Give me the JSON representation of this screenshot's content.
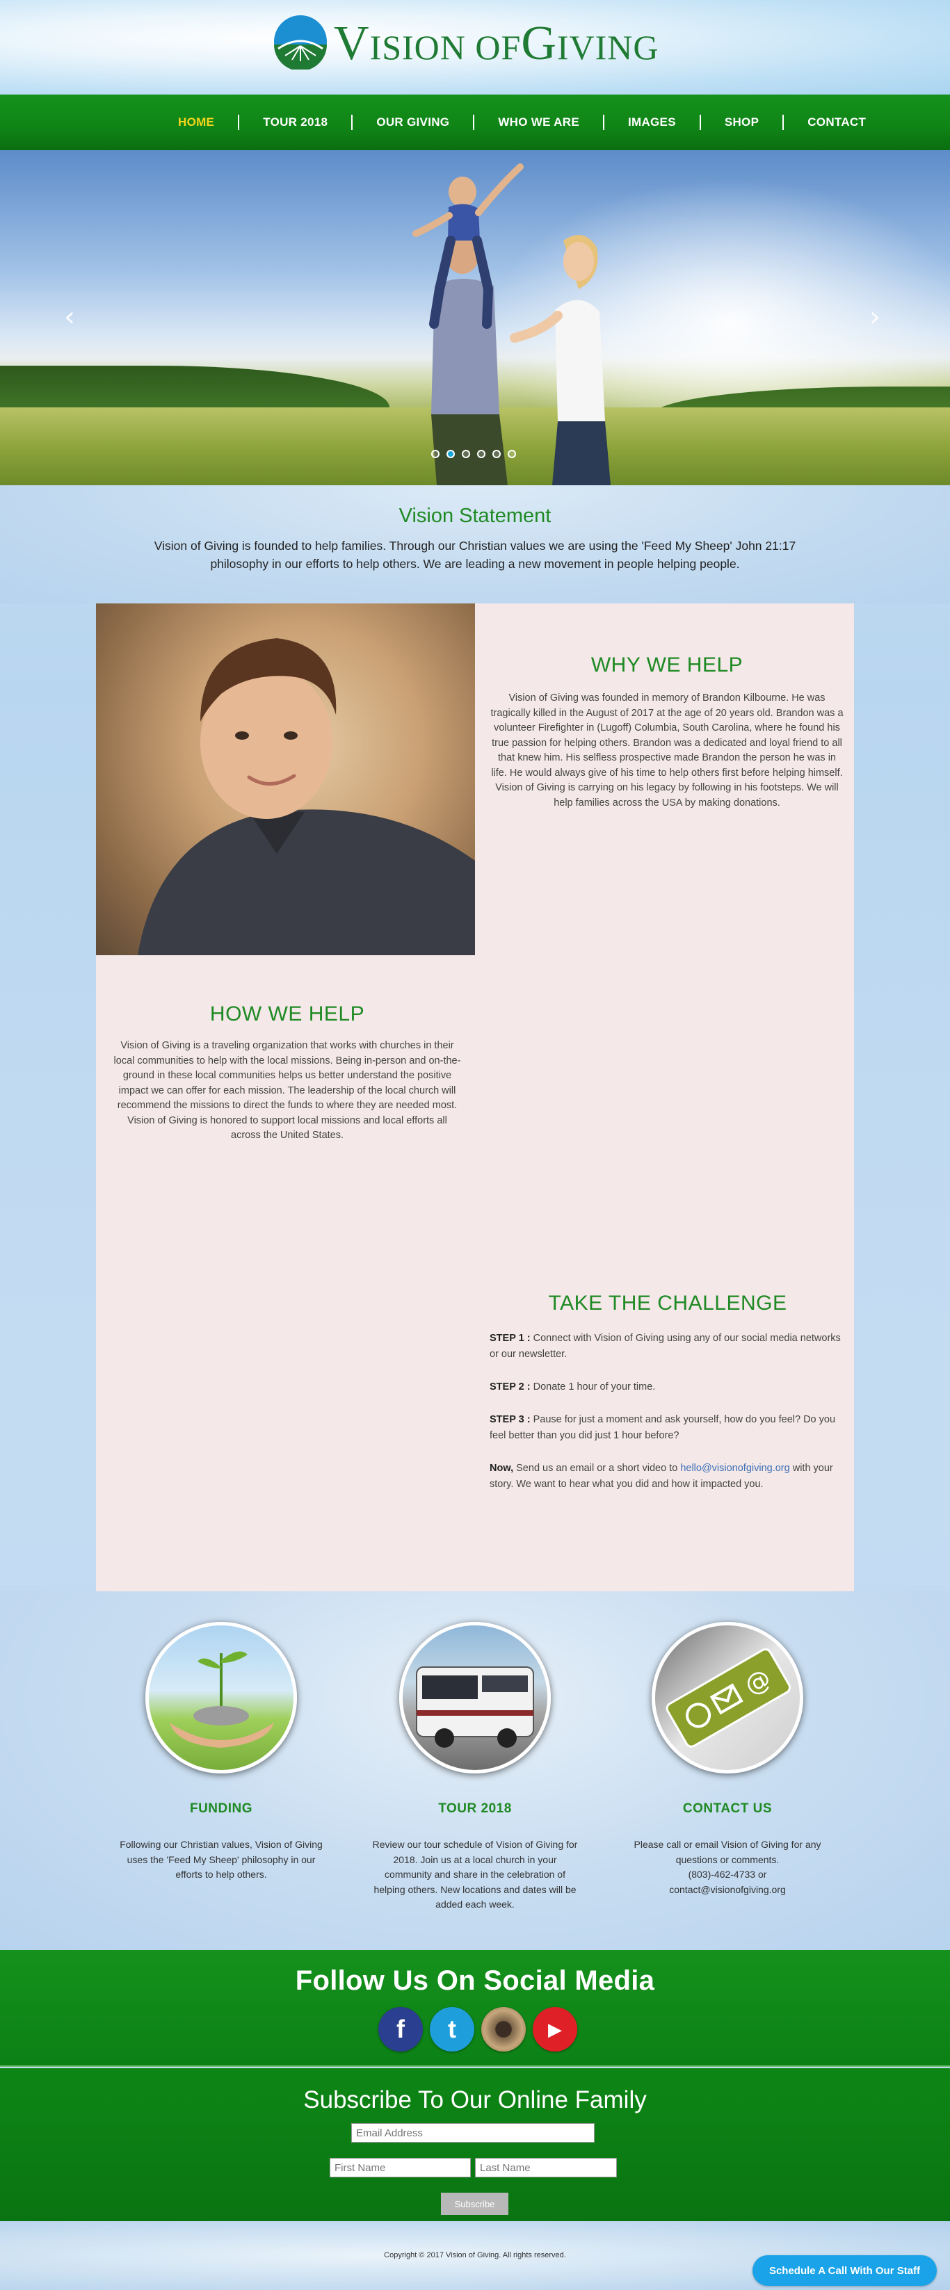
{
  "site": {
    "logo_text_prefix": "V",
    "logo_text_small1": "ISION",
    "logo_text_small2": " OF",
    "logo_text_g": "G",
    "logo_text_small3": "IVING"
  },
  "nav": {
    "items": [
      {
        "label": "HOME",
        "active": true
      },
      {
        "label": "TOUR 2018"
      },
      {
        "label": "OUR GIVING"
      },
      {
        "label": "WHO WE ARE"
      },
      {
        "label": "IMAGES"
      },
      {
        "label": "SHOP"
      },
      {
        "label": "CONTACT"
      }
    ]
  },
  "hero": {
    "prev_glyph": "‹",
    "next_glyph": "›",
    "slide_count": 6,
    "active_slide": 2
  },
  "vision": {
    "title": "Vision Statement",
    "body": "Vision of Giving is founded to help families. Through our Christian values we are using the 'Feed My Sheep' John 21:17 philosophy in our efforts to help others. We are leading a new movement in people helping people."
  },
  "why": {
    "title": "WHY WE HELP",
    "body": "Vision of Giving was founded in memory of Brandon Kilbourne. He was tragically killed in the August of 2017 at the age of 20 years old. Brandon was a volunteer Firefighter in (Lugoff) Columbia, South Carolina, where he found his true passion for helping others. Brandon was a dedicated and loyal friend to all that knew him. His selfless prospective made Brandon the person he was in life. He would always give of his time to help others first before helping himself. Vision of Giving is carrying on his legacy by following in his footsteps. We will help families across the USA by making donations."
  },
  "how": {
    "title": "HOW WE HELP",
    "body": "Vision of Giving is a traveling organization that works with churches in their local communities to help with the local missions. Being in-person and on-the-ground in these local communities helps us better understand the positive impact we can offer for each mission. The leadership of the local church will recommend the missions to direct the funds to where they are needed most. Vision of Giving is honored to support local missions and local efforts all across the United States."
  },
  "challenge": {
    "title": "TAKE THE CHALLENGE",
    "step1_label": "STEP 1 :",
    "step1_text": " Connect with Vision of Giving using any of our social media networks or our newsletter.",
    "step2_label": "STEP 2 :",
    "step2_text": " Donate 1 hour of your time.",
    "step3_label": "STEP 3 :",
    "step3_text": " Pause for just a moment and ask yourself, how do you feel? Do you feel better than you did just 1 hour before?",
    "now_label": "Now,",
    "now_text_a": " Send us an email or a short video to ",
    "now_email": "hello@visionofgiving.org",
    "now_text_b": " with your story. We want to hear what you did and how it impacted you."
  },
  "features": [
    {
      "title": "FUNDING",
      "body": "Following our Christian values, Vision of Giving uses the 'Feed My Sheep' philosophy in our efforts to help others."
    },
    {
      "title": "TOUR 2018",
      "body": "Review our tour schedule of Vision of Giving for 2018. Join us at a local church in your community and share in the celebration of helping others. New locations and dates will be added each week."
    },
    {
      "title": "CONTACT US",
      "body_line1": "Please call or email Vision of Giving for any questions or comments.",
      "body_line2": "(803)-462-4733 or",
      "body_line3": "contact@visionofgiving.org"
    }
  ],
  "social": {
    "title": "Follow Us On Social Media",
    "fb_glyph": "f",
    "tw_glyph": "t",
    "yt_glyph": "▶"
  },
  "subscribe": {
    "title": "Subscribe To Our Online Family",
    "email_placeholder": "Email Address",
    "first_placeholder": "First Name",
    "last_placeholder": "Last Name",
    "button": "Subscribe"
  },
  "footer": {
    "copyright": "Copyright © 2017 Vision of Giving. All rights reserved.",
    "cta": "Schedule A Call With Our Staff"
  },
  "colors": {
    "brand_green": "#1f8a24",
    "nav_green": "#0f8416",
    "nav_active": "#f7d51d",
    "cta_blue": "#1aa3e8"
  }
}
